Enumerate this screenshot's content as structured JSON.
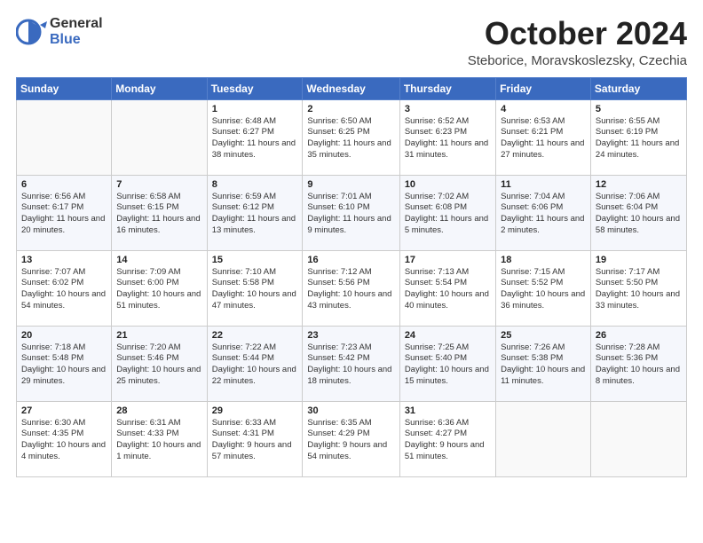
{
  "header": {
    "logo_general": "General",
    "logo_blue": "Blue",
    "month_title": "October 2024",
    "location": "Steborice, Moravskoslezsky, Czechia"
  },
  "days_of_week": [
    "Sunday",
    "Monday",
    "Tuesday",
    "Wednesday",
    "Thursday",
    "Friday",
    "Saturday"
  ],
  "weeks": [
    [
      {
        "day": "",
        "detail": ""
      },
      {
        "day": "",
        "detail": ""
      },
      {
        "day": "1",
        "detail": "Sunrise: 6:48 AM\nSunset: 6:27 PM\nDaylight: 11 hours and 38 minutes."
      },
      {
        "day": "2",
        "detail": "Sunrise: 6:50 AM\nSunset: 6:25 PM\nDaylight: 11 hours and 35 minutes."
      },
      {
        "day": "3",
        "detail": "Sunrise: 6:52 AM\nSunset: 6:23 PM\nDaylight: 11 hours and 31 minutes."
      },
      {
        "day": "4",
        "detail": "Sunrise: 6:53 AM\nSunset: 6:21 PM\nDaylight: 11 hours and 27 minutes."
      },
      {
        "day": "5",
        "detail": "Sunrise: 6:55 AM\nSunset: 6:19 PM\nDaylight: 11 hours and 24 minutes."
      }
    ],
    [
      {
        "day": "6",
        "detail": "Sunrise: 6:56 AM\nSunset: 6:17 PM\nDaylight: 11 hours and 20 minutes."
      },
      {
        "day": "7",
        "detail": "Sunrise: 6:58 AM\nSunset: 6:15 PM\nDaylight: 11 hours and 16 minutes."
      },
      {
        "day": "8",
        "detail": "Sunrise: 6:59 AM\nSunset: 6:12 PM\nDaylight: 11 hours and 13 minutes."
      },
      {
        "day": "9",
        "detail": "Sunrise: 7:01 AM\nSunset: 6:10 PM\nDaylight: 11 hours and 9 minutes."
      },
      {
        "day": "10",
        "detail": "Sunrise: 7:02 AM\nSunset: 6:08 PM\nDaylight: 11 hours and 5 minutes."
      },
      {
        "day": "11",
        "detail": "Sunrise: 7:04 AM\nSunset: 6:06 PM\nDaylight: 11 hours and 2 minutes."
      },
      {
        "day": "12",
        "detail": "Sunrise: 7:06 AM\nSunset: 6:04 PM\nDaylight: 10 hours and 58 minutes."
      }
    ],
    [
      {
        "day": "13",
        "detail": "Sunrise: 7:07 AM\nSunset: 6:02 PM\nDaylight: 10 hours and 54 minutes."
      },
      {
        "day": "14",
        "detail": "Sunrise: 7:09 AM\nSunset: 6:00 PM\nDaylight: 10 hours and 51 minutes."
      },
      {
        "day": "15",
        "detail": "Sunrise: 7:10 AM\nSunset: 5:58 PM\nDaylight: 10 hours and 47 minutes."
      },
      {
        "day": "16",
        "detail": "Sunrise: 7:12 AM\nSunset: 5:56 PM\nDaylight: 10 hours and 43 minutes."
      },
      {
        "day": "17",
        "detail": "Sunrise: 7:13 AM\nSunset: 5:54 PM\nDaylight: 10 hours and 40 minutes."
      },
      {
        "day": "18",
        "detail": "Sunrise: 7:15 AM\nSunset: 5:52 PM\nDaylight: 10 hours and 36 minutes."
      },
      {
        "day": "19",
        "detail": "Sunrise: 7:17 AM\nSunset: 5:50 PM\nDaylight: 10 hours and 33 minutes."
      }
    ],
    [
      {
        "day": "20",
        "detail": "Sunrise: 7:18 AM\nSunset: 5:48 PM\nDaylight: 10 hours and 29 minutes."
      },
      {
        "day": "21",
        "detail": "Sunrise: 7:20 AM\nSunset: 5:46 PM\nDaylight: 10 hours and 25 minutes."
      },
      {
        "day": "22",
        "detail": "Sunrise: 7:22 AM\nSunset: 5:44 PM\nDaylight: 10 hours and 22 minutes."
      },
      {
        "day": "23",
        "detail": "Sunrise: 7:23 AM\nSunset: 5:42 PM\nDaylight: 10 hours and 18 minutes."
      },
      {
        "day": "24",
        "detail": "Sunrise: 7:25 AM\nSunset: 5:40 PM\nDaylight: 10 hours and 15 minutes."
      },
      {
        "day": "25",
        "detail": "Sunrise: 7:26 AM\nSunset: 5:38 PM\nDaylight: 10 hours and 11 minutes."
      },
      {
        "day": "26",
        "detail": "Sunrise: 7:28 AM\nSunset: 5:36 PM\nDaylight: 10 hours and 8 minutes."
      }
    ],
    [
      {
        "day": "27",
        "detail": "Sunrise: 6:30 AM\nSunset: 4:35 PM\nDaylight: 10 hours and 4 minutes."
      },
      {
        "day": "28",
        "detail": "Sunrise: 6:31 AM\nSunset: 4:33 PM\nDaylight: 10 hours and 1 minute."
      },
      {
        "day": "29",
        "detail": "Sunrise: 6:33 AM\nSunset: 4:31 PM\nDaylight: 9 hours and 57 minutes."
      },
      {
        "day": "30",
        "detail": "Sunrise: 6:35 AM\nSunset: 4:29 PM\nDaylight: 9 hours and 54 minutes."
      },
      {
        "day": "31",
        "detail": "Sunrise: 6:36 AM\nSunset: 4:27 PM\nDaylight: 9 hours and 51 minutes."
      },
      {
        "day": "",
        "detail": ""
      },
      {
        "day": "",
        "detail": ""
      }
    ]
  ]
}
